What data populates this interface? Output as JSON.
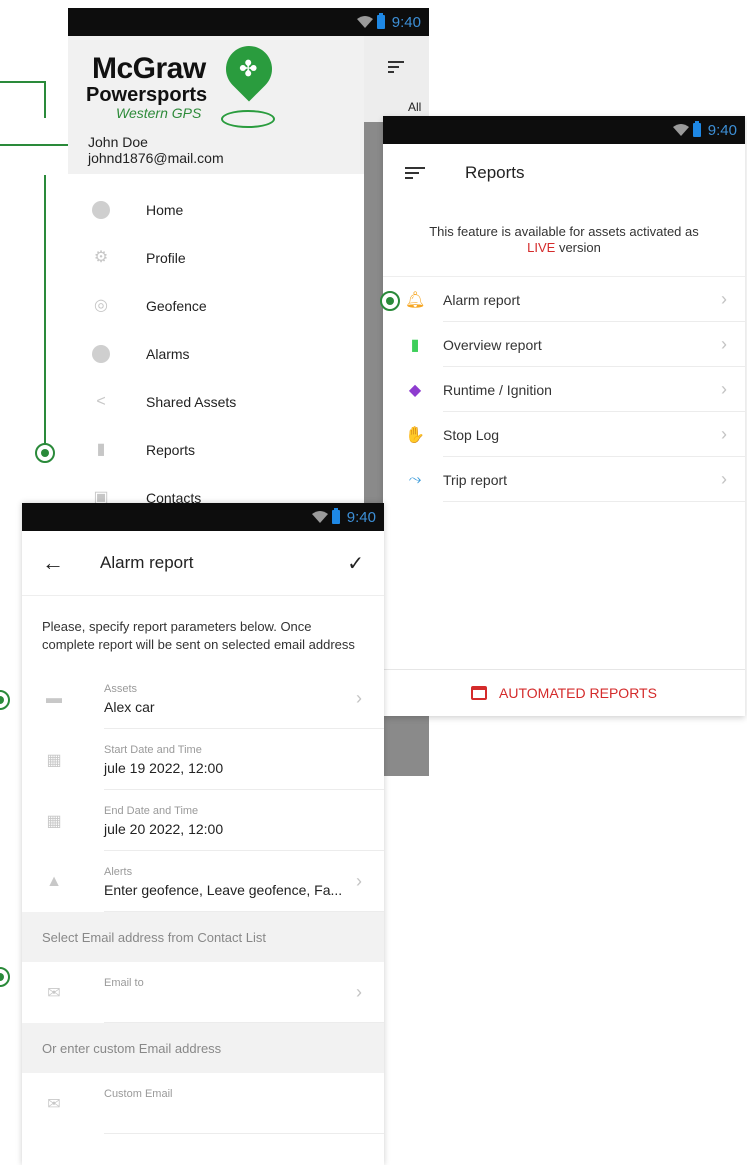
{
  "status": {
    "time": "9:40"
  },
  "drawer": {
    "logo": {
      "line1": "McGraw",
      "line2": "Powersports",
      "line3": "Western GPS"
    },
    "user": {
      "name": "John Doe",
      "email": "johnd1876@mail.com"
    },
    "background_label": "All",
    "items": [
      {
        "label": "Home",
        "icon": "home-icon"
      },
      {
        "label": "Profile",
        "icon": "gear-icon"
      },
      {
        "label": "Geofence",
        "icon": "geofence-icon"
      },
      {
        "label": "Alarms",
        "icon": "alarm-icon"
      },
      {
        "label": "Shared Assets",
        "icon": "share-icon"
      },
      {
        "label": "Reports",
        "icon": "bar-chart-icon"
      },
      {
        "label": "Contacts",
        "icon": "contacts-icon"
      }
    ]
  },
  "reports": {
    "title": "Reports",
    "notice": "This feature is available for assets activated as",
    "notice_live": "LIVE",
    "notice_suffix": "version",
    "items": [
      {
        "label": "Alarm report",
        "icon": "bell-icon",
        "color": "#f5a623"
      },
      {
        "label": "Overview report",
        "icon": "document-icon",
        "color": "#3ecf5a"
      },
      {
        "label": "Runtime / Ignition",
        "icon": "ignition-icon",
        "color": "#8e3ccf"
      },
      {
        "label": "Stop Log",
        "icon": "hand-icon",
        "color": "#e0262d"
      },
      {
        "label": "Trip report",
        "icon": "trip-icon",
        "color": "#3a9ad9"
      }
    ],
    "automated_label": "AUTOMATED REPORTS"
  },
  "alarm_report": {
    "title": "Alarm report",
    "description": "Please, specify report parameters below. Once complete report will be sent on selected email address",
    "fields": [
      {
        "caption": "Assets",
        "value": "Alex car",
        "icon": "car-icon"
      },
      {
        "caption": "Start Date and Time",
        "value": "jule 19 2022, 12:00",
        "icon": "calendar-icon"
      },
      {
        "caption": "End Date and Time",
        "value": "jule 20 2022, 12:00",
        "icon": "calendar-icon"
      },
      {
        "caption": "Alerts",
        "value": "Enter geofence, Leave geofence, Fa...",
        "icon": "bell-icon"
      }
    ],
    "section_contacts": "Select Email address from Contact List",
    "email_to_caption": "Email to",
    "section_custom": "Or enter custom Email address",
    "custom_email_caption": "Custom Email"
  },
  "colors": {
    "accent_green": "#2a8a3a",
    "live_red": "#d42b2b",
    "status_blue": "#3d8fd6"
  }
}
